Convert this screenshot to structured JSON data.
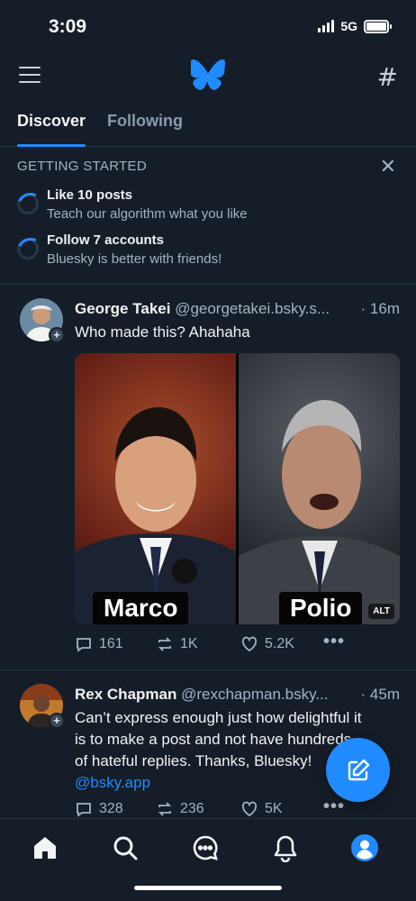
{
  "status_bar": {
    "time": "3:09",
    "network": "5G"
  },
  "tabs": [
    {
      "label": "Discover",
      "active": true
    },
    {
      "label": "Following",
      "active": false
    }
  ],
  "getting_started": {
    "title": "GETTING STARTED",
    "tasks": [
      {
        "title": "Like 10 posts",
        "subtitle": "Teach our algorithm what you like"
      },
      {
        "title": "Follow 7 accounts",
        "subtitle": "Bluesky is better with friends!"
      }
    ]
  },
  "posts": [
    {
      "display_name": "George Takei",
      "handle": "@georgetakei.bsky.s...",
      "time": "· 16m",
      "text": "Who made this? Ahahaha",
      "images": [
        {
          "caption": "Marco"
        },
        {
          "caption": "Polio"
        }
      ],
      "alt_label": "ALT",
      "replies": "161",
      "reposts": "1K",
      "likes": "5.2K"
    },
    {
      "display_name": "Rex Chapman",
      "handle": "@rexchapman.bsky...",
      "time": "· 45m",
      "text_lines": [
        "Can’t express enough just how delightful it",
        "is to make a post and not have hundreds",
        "of hateful replies. Thanks, Bluesky!"
      ],
      "mention": "@bsky.app",
      "replies": "328",
      "reposts": "236",
      "likes": "5K"
    }
  ],
  "colors": {
    "background": "#151d28",
    "accent": "#208bfe",
    "muted_text": "#a5b2c2",
    "divider": "#2a3442"
  },
  "icons": {
    "top_bar": [
      "menu-icon",
      "butterfly-logo-icon",
      "hashtag-icon"
    ],
    "bottom_nav": [
      "home-icon",
      "search-icon",
      "chat-icon",
      "bell-icon",
      "profile-icon"
    ],
    "post_actions": [
      "reply-icon",
      "repost-icon",
      "like-icon",
      "more-icon"
    ],
    "fab": "compose-icon"
  }
}
